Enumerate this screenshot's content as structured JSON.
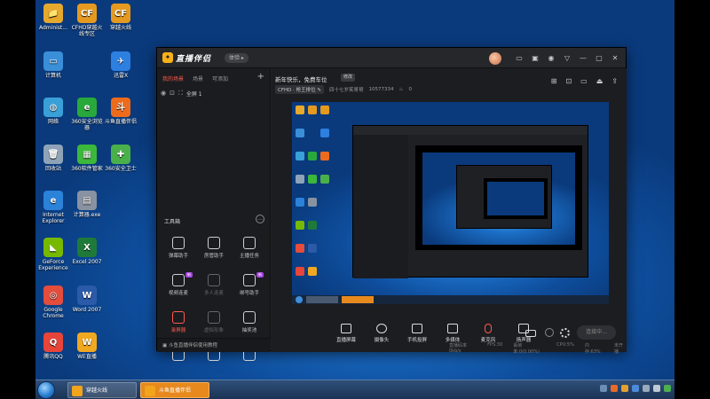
{
  "desktop": {
    "icons": [
      {
        "label": "Administ...",
        "color": "#e6a92e",
        "glyph": "📁"
      },
      {
        "label": "CFHD穿越火线专区",
        "color": "#e59a1f",
        "glyph": "CF"
      },
      {
        "label": "穿越火线",
        "color": "#e59a1f",
        "glyph": "CF"
      },
      {
        "label": "计算机",
        "color": "#3a8fd8",
        "glyph": "▭"
      },
      {
        "label": "迅雷X",
        "color": "#2d7fe0",
        "glyph": "✈"
      },
      {
        "label": "网络",
        "color": "#3aa0d8",
        "glyph": "◍"
      },
      {
        "label": "360安全浏览器",
        "color": "#29a83c",
        "glyph": "e"
      },
      {
        "label": "斗鱼直播伴侣",
        "color": "#ef6b1c",
        "glyph": "斗"
      },
      {
        "label": "回收站",
        "color": "#8fa3b8",
        "glyph": "🗑"
      },
      {
        "label": "360软件管家",
        "color": "#3cb83c",
        "glyph": "▦"
      },
      {
        "label": "360安全卫士",
        "color": "#4ab14a",
        "glyph": "✚"
      },
      {
        "label": "Internet Explorer",
        "color": "#2b82d9",
        "glyph": "e"
      },
      {
        "label": "计算器.exe",
        "color": "#8892a0",
        "glyph": "▤"
      },
      {
        "label": "GeForce Experience",
        "color": "#76b900",
        "glyph": "◣"
      },
      {
        "label": "Excel 2007",
        "color": "#1f7a3a",
        "glyph": "X"
      },
      {
        "label": "Google Chrome",
        "color": "#e44c3c",
        "glyph": "◎"
      },
      {
        "label": "Word 2007",
        "color": "#2a5aa8",
        "glyph": "W"
      },
      {
        "label": "腾讯QQ",
        "color": "#e7453a",
        "glyph": "Q"
      },
      {
        "label": "WE直播",
        "color": "#f0a820",
        "glyph": "W"
      }
    ]
  },
  "app": {
    "logo": "直播伴侣",
    "version": "体验",
    "titlebar_buttons": [
      "▭",
      "▣",
      "◉",
      "▽",
      "—",
      "▢",
      "✕"
    ],
    "scene_tabs": [
      "我的场景",
      "场景",
      "可添加"
    ],
    "add_scene": "+",
    "source": {
      "label": "全屏 1"
    },
    "toolbox_title": "工具箱",
    "toolbox_more": "…",
    "tools": [
      {
        "label": "弹幕助手",
        "state": "normal",
        "tag": ""
      },
      {
        "label": "房管助手",
        "state": "normal",
        "tag": ""
      },
      {
        "label": "主播任务",
        "state": "normal",
        "tag": ""
      },
      {
        "label": "视频连麦",
        "state": "normal",
        "tag": "新"
      },
      {
        "label": "多人连麦",
        "state": "dim",
        "tag": ""
      },
      {
        "label": "绑号助手",
        "state": "normal",
        "tag": "新"
      },
      {
        "label": "录屏器",
        "state": "hot",
        "tag": ""
      },
      {
        "label": "虚拟形象",
        "state": "dim",
        "tag": ""
      },
      {
        "label": "抽奖池",
        "state": "normal",
        "tag": ""
      },
      {
        "label": "",
        "state": "normal",
        "tag": ""
      },
      {
        "label": "",
        "state": "normal",
        "tag": "新"
      },
      {
        "label": "",
        "state": "normal",
        "tag": ""
      }
    ],
    "left_bottom": "斗鱼直播伴侣使用教程",
    "main": {
      "live_title": "新年快乐，免费车位",
      "edit": "修改",
      "category": "CFHD · 枪王排位",
      "room_name": "四十七岁笑哥哥",
      "room_id": "10577334",
      "popularity": "0",
      "right_icons": [
        "⊞",
        "⊡",
        "▭",
        "⏏",
        "⇪"
      ]
    },
    "bottom_toolbar": [
      {
        "label": "直播屏幕",
        "shape": "square"
      },
      {
        "label": "摄像头",
        "shape": "round"
      },
      {
        "label": "手机投屏",
        "shape": "square"
      },
      {
        "label": "多媒体",
        "shape": "square"
      },
      {
        "label": "麦克风",
        "shape": "mic"
      },
      {
        "label": "扬声器",
        "shape": "square"
      }
    ],
    "start_live": "连接中...",
    "status": [
      "直播码率0kb/s",
      "FPS:30",
      "丢帧率:0(0.00%)",
      "CPU:5%",
      "内存:63%",
      "未开播"
    ]
  },
  "taskbar": {
    "items": [
      {
        "label": "穿越火线",
        "active": false
      },
      {
        "label": "斗鱼直播伴侣",
        "active": true
      }
    ],
    "tray_colors": [
      "#6c8db5",
      "#e86a2a",
      "#e2a030",
      "#4c8ad8",
      "#9aa9bb",
      "#c0c8d3",
      "#4caf50"
    ]
  }
}
